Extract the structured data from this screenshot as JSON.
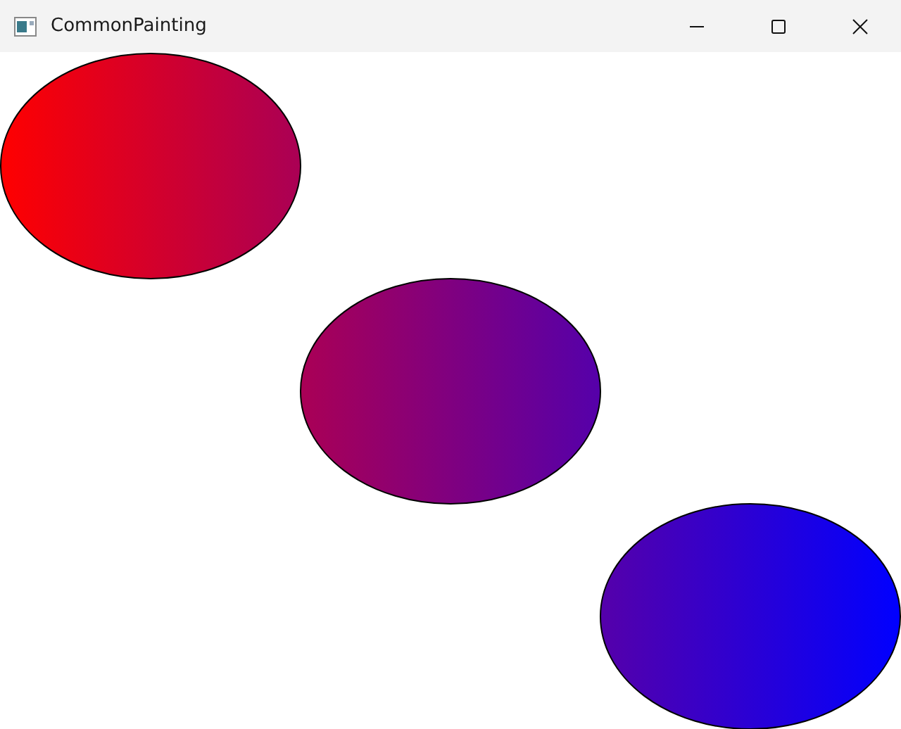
{
  "window": {
    "title": "CommonPainting"
  },
  "canvas": {
    "shapes": [
      {
        "kind": "ellipse"
      },
      {
        "kind": "ellipse"
      },
      {
        "kind": "ellipse"
      }
    ]
  }
}
